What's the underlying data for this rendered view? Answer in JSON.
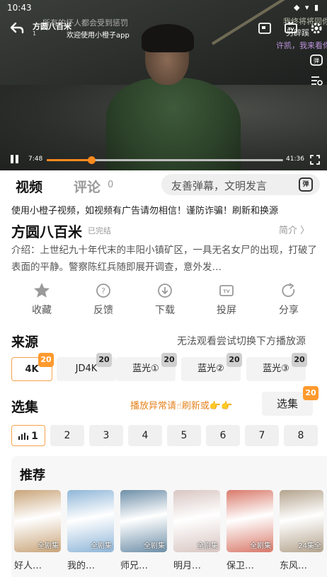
{
  "status_bar": {
    "time": "10:43",
    "icons": "◆ ▾ ▮"
  },
  "player": {
    "title": "方圆八百米",
    "episode": "1",
    "welcome": "欢迎使用小橙子app",
    "danmaku": [
      {
        "text": "所有的坏人都会受到惩罚",
        "color": "#c4c4c4"
      },
      {
        "text": "我终将将同你站在一起",
        "color": "#cfd7c0"
      },
      {
        "text": "另辟蹊",
        "color": "#ffffff"
      },
      {
        "text": "许凯，我来看你",
        "color": "#d9a6ff"
      }
    ],
    "current_time": "7:48",
    "total_time": "41:36",
    "progress": 0.19,
    "icons": [
      "back-icon",
      "cast-icon",
      "tv-icon",
      "settings-icon",
      "danmaku-icon",
      "danmaku-settings-icon",
      "pause-icon",
      "fullscreen-icon"
    ]
  },
  "tabs": {
    "video": "视频",
    "comment": "评论",
    "comment_count": "0",
    "danmaku_placeholder": "友善弹幕，文明发言",
    "danmaku_button": "弹"
  },
  "notice": "使用小橙子视频，如视频有广告请勿相信！谨防诈骗！刷新和换源",
  "show": {
    "title": "方圆八百米",
    "status": "已完结",
    "intro_link": "简介 〉",
    "intro": "介绍：上世纪九十年代末的丰阳小镇矿区，一具无名女尸的出现，打破了表面的平静。警察陈红兵随即展开调查，意外发…"
  },
  "actions": [
    {
      "label": "收藏",
      "icon": "star-icon"
    },
    {
      "label": "反馈",
      "icon": "feedback-icon"
    },
    {
      "label": "下载",
      "icon": "download-icon"
    },
    {
      "label": "投屏",
      "icon": "tv-cast-icon"
    },
    {
      "label": "分享",
      "icon": "share-icon"
    }
  ],
  "source": {
    "title": "来源",
    "hint": "无法观看尝试切换下方播放源",
    "items": [
      {
        "label": "4K",
        "badge": "20",
        "active": true
      },
      {
        "label": "JD4K",
        "badge": "20",
        "active": false
      },
      {
        "label": "蓝光①",
        "badge": "20",
        "active": false
      },
      {
        "label": "蓝光②",
        "badge": "20",
        "active": false
      },
      {
        "label": "蓝光③",
        "badge": "20",
        "active": false
      }
    ]
  },
  "episodes": {
    "title": "选集",
    "hint": "播放异常请☝刷新或👉👉",
    "select_label": "选集",
    "select_badge": "20",
    "items": [
      "1",
      "2",
      "3",
      "4",
      "5",
      "6",
      "7",
      "8"
    ],
    "active": 0
  },
  "recommend": {
    "title": "推荐",
    "items": [
      {
        "title": "好人…",
        "tag": "全剧集",
        "color": "#c9a57a"
      },
      {
        "title": "我的…",
        "tag": "全剧集",
        "color": "#8fb6d8"
      },
      {
        "title": "师兄…",
        "tag": "全剧集",
        "color": "#6e8fa8"
      },
      {
        "title": "明月…",
        "tag": "全剧集",
        "color": "#d8c6c2"
      },
      {
        "title": "保卫…",
        "tag": "全剧集",
        "color": "#d97a6a"
      },
      {
        "title": "东风…",
        "tag": "24集全",
        "color": "#b4a48e"
      }
    ]
  },
  "colors": {
    "accent": "#ff8a1e",
    "badge": "#ff9a2e"
  }
}
